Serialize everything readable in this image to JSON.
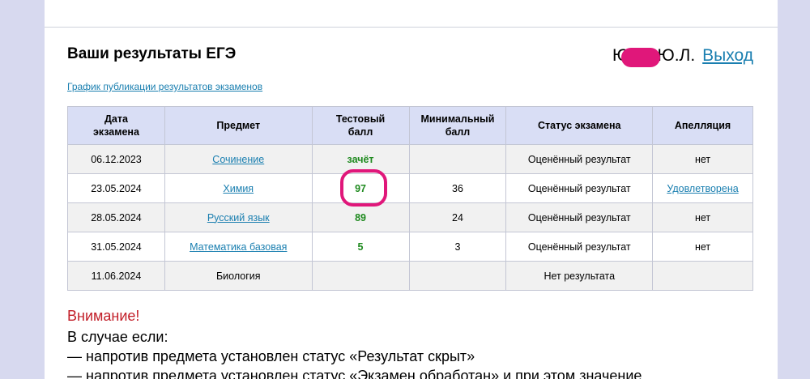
{
  "header": {
    "title": "Ваши результаты ЕГЭ",
    "user_name": "Ю      ва Ю.Л.",
    "logout_label": "Выход"
  },
  "schedule_link": "График публикации результатов экзаменов",
  "table": {
    "columns": [
      "Дата экзамена",
      "Предмет",
      "Тестовый балл",
      "Минимальный балл",
      "Статус экзамена",
      "Апелляция"
    ],
    "rows": [
      {
        "date": "06.12.2023",
        "subject": "Сочинение",
        "score": "зачёт",
        "min": "",
        "status": "Оценённый результат",
        "appeal": "нет"
      },
      {
        "date": "23.05.2024",
        "subject": "Химия",
        "score": "97",
        "min": "36",
        "status": "Оценённый результат",
        "appeal": "Удовлетворена"
      },
      {
        "date": "28.05.2024",
        "subject": "Русский язык",
        "score": "89",
        "min": "24",
        "status": "Оценённый результат",
        "appeal": "нет"
      },
      {
        "date": "31.05.2024",
        "subject": "Математика базовая",
        "score": "5",
        "min": "3",
        "status": "Оценённый результат",
        "appeal": "нет"
      },
      {
        "date": "11.06.2024",
        "subject": "Биология",
        "score": "",
        "min": "",
        "status": "Нет результата",
        "appeal": ""
      }
    ]
  },
  "attention": {
    "title": "Внимание!",
    "lines": [
      "В случае если:",
      "— напротив предмета установлен статус «Результат скрыт»",
      "— напротив предмета установлен статус «Экзамен обработан» и при этом значение"
    ]
  },
  "colors": {
    "link": "#1a7fb0",
    "score": "#1f8a1f",
    "highlight": "#e0177a",
    "attention": "#c21e28",
    "header_bg": "#d9def5"
  }
}
